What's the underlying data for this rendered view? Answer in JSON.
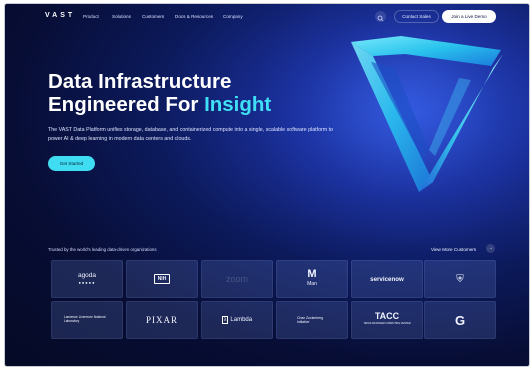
{
  "nav": {
    "logo": "VAST",
    "items": [
      "Product",
      "Solutions",
      "Customers",
      "Docs & Resources",
      "Company"
    ],
    "contact": "Contact Sales",
    "demo": "Join a Live Demo",
    "search_icon": "search-icon"
  },
  "hero": {
    "title_line1": "Data Infrastructure",
    "title_line2_prefix": "Engineered For ",
    "title_line2_accent": "Insight",
    "description": "The VAST Data Platform unifies storage, database, and containerized compute into a single, scalable software platform to power AI & deep learning in modern data centers and clouds.",
    "cta": "Get Started"
  },
  "customers": {
    "trusted": "Trusted by the world's leading data-driven organizations",
    "view_more": "View More Customers",
    "arrow": "→",
    "logos": [
      {
        "name": "agoda",
        "text": "agoda",
        "sub": "●●●●●"
      },
      {
        "name": "nih",
        "text": "NIH"
      },
      {
        "name": "zoom",
        "text": "zoom"
      },
      {
        "name": "man",
        "text": "M",
        "sub": "Man"
      },
      {
        "name": "servicenow",
        "text": "servicenow"
      },
      {
        "name": "nhl",
        "text": "⛨"
      },
      {
        "name": "lawrence",
        "text": "Lawrence Livermore National Laboratory"
      },
      {
        "name": "pixar",
        "text": "PIXAR"
      },
      {
        "name": "lambda",
        "text": "Lambda"
      },
      {
        "name": "czbiohub",
        "text": "Chan Zuckerberg Initiative"
      },
      {
        "name": "tacc",
        "text": "TACC",
        "sub": "TEXAS ADVANCED COMPUTING CENTER"
      },
      {
        "name": "g-logo",
        "text": "G"
      }
    ]
  },
  "colors": {
    "accent": "#3fe0f5",
    "background": "#070d34",
    "button_bg": "#ffffff"
  }
}
